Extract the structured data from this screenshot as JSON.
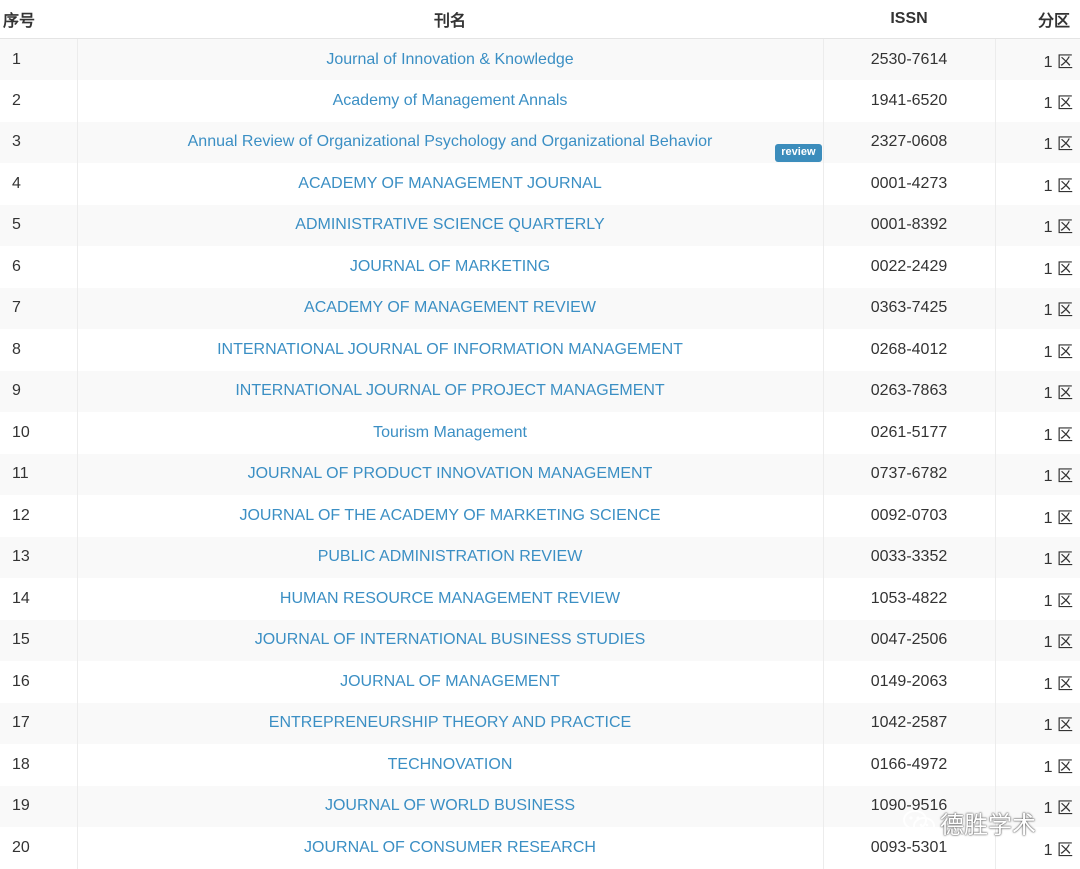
{
  "table": {
    "headers": {
      "index": "序号",
      "name": "刊名",
      "issn": "ISSN",
      "zone": "分区"
    },
    "rows": [
      {
        "index": "1",
        "name": "Journal of Innovation & Knowledge",
        "issn": "2530-7614",
        "zone": "1 区"
      },
      {
        "index": "2",
        "name": "Academy of Management Annals",
        "issn": "1941-6520",
        "zone": "1 区"
      },
      {
        "index": "3",
        "name": "Annual Review of Organizational Psychology and Organizational Behavior",
        "issn": "2327-0608",
        "zone": "1 区",
        "badge": "review"
      },
      {
        "index": "4",
        "name": "ACADEMY OF MANAGEMENT JOURNAL",
        "issn": "0001-4273",
        "zone": "1 区"
      },
      {
        "index": "5",
        "name": "ADMINISTRATIVE SCIENCE QUARTERLY",
        "issn": "0001-8392",
        "zone": "1 区"
      },
      {
        "index": "6",
        "name": "JOURNAL OF MARKETING",
        "issn": "0022-2429",
        "zone": "1 区"
      },
      {
        "index": "7",
        "name": "ACADEMY OF MANAGEMENT REVIEW",
        "issn": "0363-7425",
        "zone": "1 区"
      },
      {
        "index": "8",
        "name": "INTERNATIONAL JOURNAL OF INFORMATION MANAGEMENT",
        "issn": "0268-4012",
        "zone": "1 区"
      },
      {
        "index": "9",
        "name": "INTERNATIONAL JOURNAL OF PROJECT MANAGEMENT",
        "issn": "0263-7863",
        "zone": "1 区"
      },
      {
        "index": "10",
        "name": "Tourism Management",
        "issn": "0261-5177",
        "zone": "1 区"
      },
      {
        "index": "11",
        "name": "JOURNAL OF PRODUCT INNOVATION MANAGEMENT",
        "issn": "0737-6782",
        "zone": "1 区"
      },
      {
        "index": "12",
        "name": "JOURNAL OF THE ACADEMY OF MARKETING SCIENCE",
        "issn": "0092-0703",
        "zone": "1 区"
      },
      {
        "index": "13",
        "name": "PUBLIC ADMINISTRATION REVIEW",
        "issn": "0033-3352",
        "zone": "1 区"
      },
      {
        "index": "14",
        "name": "HUMAN RESOURCE MANAGEMENT REVIEW",
        "issn": "1053-4822",
        "zone": "1 区"
      },
      {
        "index": "15",
        "name": "JOURNAL OF INTERNATIONAL BUSINESS STUDIES",
        "issn": "0047-2506",
        "zone": "1 区"
      },
      {
        "index": "16",
        "name": "JOURNAL OF MANAGEMENT",
        "issn": "0149-2063",
        "zone": "1 区"
      },
      {
        "index": "17",
        "name": "ENTREPRENEURSHIP THEORY AND PRACTICE",
        "issn": "1042-2587",
        "zone": "1 区"
      },
      {
        "index": "18",
        "name": "TECHNOVATION",
        "issn": "0166-4972",
        "zone": "1 区"
      },
      {
        "index": "19",
        "name": "JOURNAL OF WORLD BUSINESS",
        "issn": "1090-9516",
        "zone": "1 区"
      },
      {
        "index": "20",
        "name": "JOURNAL OF CONSUMER RESEARCH",
        "issn": "0093-5301",
        "zone": "1 区"
      }
    ]
  },
  "watermark": {
    "text": "德胜学术",
    "icon": "wechat-icon"
  },
  "colors": {
    "link": "#3b8fc4",
    "badge": "#3c8dbc",
    "stripe": "#f9f9f9"
  }
}
